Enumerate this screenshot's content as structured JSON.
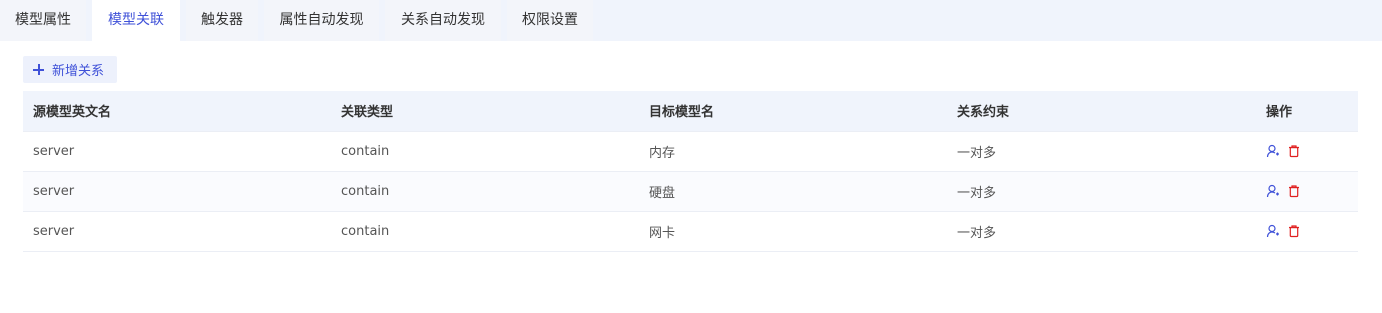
{
  "tabs": [
    {
      "label": "模型属性",
      "active": false
    },
    {
      "label": "模型关联",
      "active": true
    },
    {
      "label": "触发器",
      "active": false
    },
    {
      "label": "属性自动发现",
      "active": false
    },
    {
      "label": "关系自动发现",
      "active": false
    },
    {
      "label": "权限设置",
      "active": false
    }
  ],
  "toolbar": {
    "add_label": "新增关系"
  },
  "table": {
    "columns": [
      "源模型英文名",
      "关联类型",
      "目标模型名",
      "关系约束",
      "操作"
    ],
    "rows": [
      {
        "source": "server",
        "type": "contain",
        "target": "内存",
        "constraint": "一对多"
      },
      {
        "source": "server",
        "type": "contain",
        "target": "硬盘",
        "constraint": "一对多"
      },
      {
        "source": "server",
        "type": "contain",
        "target": "网卡",
        "constraint": "一对多"
      }
    ]
  },
  "icons": {
    "edit": "user-edit-icon",
    "delete": "trash-icon"
  },
  "colors": {
    "accent": "#3f51d8",
    "danger": "#e02020",
    "header_bg": "#f0f4fc"
  }
}
